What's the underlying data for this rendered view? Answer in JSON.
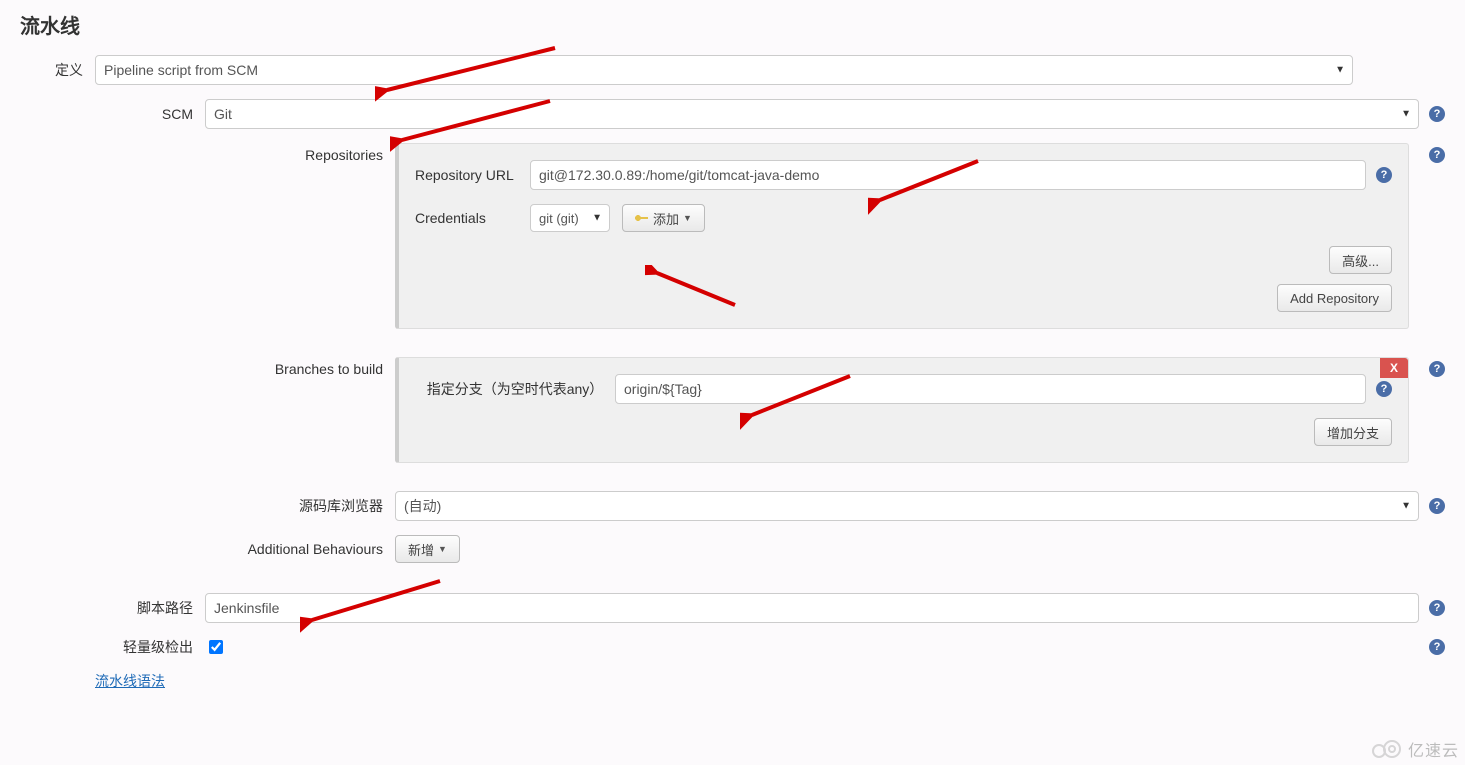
{
  "section_title": "流水线",
  "definition": {
    "label": "定义",
    "value": "Pipeline script from SCM"
  },
  "scm": {
    "label": "SCM",
    "value": "Git"
  },
  "repositories": {
    "label": "Repositories",
    "repo_url_label": "Repository URL",
    "repo_url_value": "git@172.30.0.89:/home/git/tomcat-java-demo",
    "credentials_label": "Credentials",
    "credentials_value": "git (git)",
    "add_button": "添加",
    "advanced_button": "高级...",
    "add_repo_button": "Add Repository"
  },
  "branches": {
    "label": "Branches to build",
    "branch_label": "指定分支（为空时代表any）",
    "branch_value": "origin/${Tag}",
    "add_branch_button": "增加分支",
    "close_label": "X"
  },
  "repo_browser": {
    "label": "源码库浏览器",
    "value": "(自动)"
  },
  "additional_behaviours": {
    "label": "Additional Behaviours",
    "add_button": "新增"
  },
  "script_path": {
    "label": "脚本路径",
    "value": "Jenkinsfile"
  },
  "lightweight": {
    "label": "轻量级检出",
    "checked": true
  },
  "pipeline_syntax_link": "流水线语法",
  "help_glyph": "?",
  "watermark": "亿速云"
}
